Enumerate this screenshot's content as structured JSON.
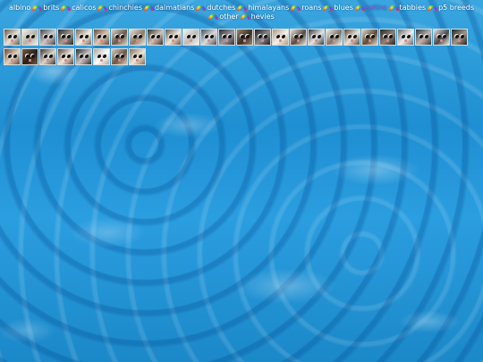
{
  "nav": [
    {
      "label": "albino"
    },
    {
      "label": "brits"
    },
    {
      "label": "calicos"
    },
    {
      "label": "chinchies"
    },
    {
      "label": "dalmatians"
    },
    {
      "label": "dutches"
    },
    {
      "label": "himalayans"
    },
    {
      "label": "roans"
    },
    {
      "label": "blues"
    },
    {
      "label": "satins",
      "current": true
    },
    {
      "label": "tabbies"
    },
    {
      "label": "p5 breeds"
    },
    {
      "label": "other"
    },
    {
      "label": "hevies"
    }
  ],
  "tiles": [
    {
      "bg": "#6b5a45",
      "fg": "#e8e2d8"
    },
    {
      "bg": "#f1efe9",
      "fg": "#b8b1a4"
    },
    {
      "bg": "#4a4a4a",
      "fg": "#c9c9c9"
    },
    {
      "bg": "#2d2a28",
      "fg": "#a19b92"
    },
    {
      "bg": "#7a6650",
      "fg": "#f2eee6"
    },
    {
      "bg": "#6a4d3b",
      "fg": "#d9c8b4"
    },
    {
      "bg": "#d8d2c8",
      "fg": "#6a5a48"
    },
    {
      "bg": "#e9e5dc",
      "fg": "#8c7a64"
    },
    {
      "bg": "#3a2f28",
      "fg": "#cfc4b6"
    },
    {
      "bg": "#6b5848",
      "fg": "#eee8de"
    },
    {
      "bg": "#f3f3f1",
      "fg": "#bcbcb8"
    },
    {
      "bg": "#4a4f5a",
      "fg": "#dcdcdc"
    },
    {
      "bg": "#2f2f33",
      "fg": "#9a9aa0"
    },
    {
      "bg": "#a08770",
      "fg": "#3b2f24"
    },
    {
      "bg": "#1f1f22",
      "fg": "#8a8a8e"
    },
    {
      "bg": "#b39a80",
      "fg": "#f5f1ea"
    },
    {
      "bg": "#e8e3dc",
      "fg": "#5a4a3c"
    },
    {
      "bg": "#3b3b3b",
      "fg": "#e3e3e3"
    },
    {
      "bg": "#f1eee8",
      "fg": "#7e7468"
    },
    {
      "bg": "#5b4a3d",
      "fg": "#eae3d8"
    },
    {
      "bg": "#e0d6c8",
      "fg": "#5e4a35"
    },
    {
      "bg": "#2a2622",
      "fg": "#8d8378"
    },
    {
      "bg": "#6d6a66",
      "fg": "#f0eeea"
    },
    {
      "bg": "#333338",
      "fg": "#b9b6b0"
    },
    {
      "bg": "#e6e4e2",
      "fg": "#4a4a4a"
    },
    {
      "bg": "#25231f",
      "fg": "#a0968a"
    },
    {
      "bg": "#6a4a32",
      "fg": "#e1d2c0"
    },
    {
      "bg": "#7a5a40",
      "fg": "#2a1f18"
    },
    {
      "bg": "#3f3a35",
      "fg": "#dcd4c8"
    },
    {
      "bg": "#5a4636",
      "fg": "#f0e8dc"
    },
    {
      "bg": "#2b2b2b",
      "fg": "#c8c8c8"
    },
    {
      "bg": "#b0a89e",
      "fg": "#ffffff"
    },
    {
      "bg": "#d7ccbd",
      "fg": "#6b5642"
    },
    {
      "bg": "#8a7056",
      "fg": "#efe6da"
    }
  ]
}
